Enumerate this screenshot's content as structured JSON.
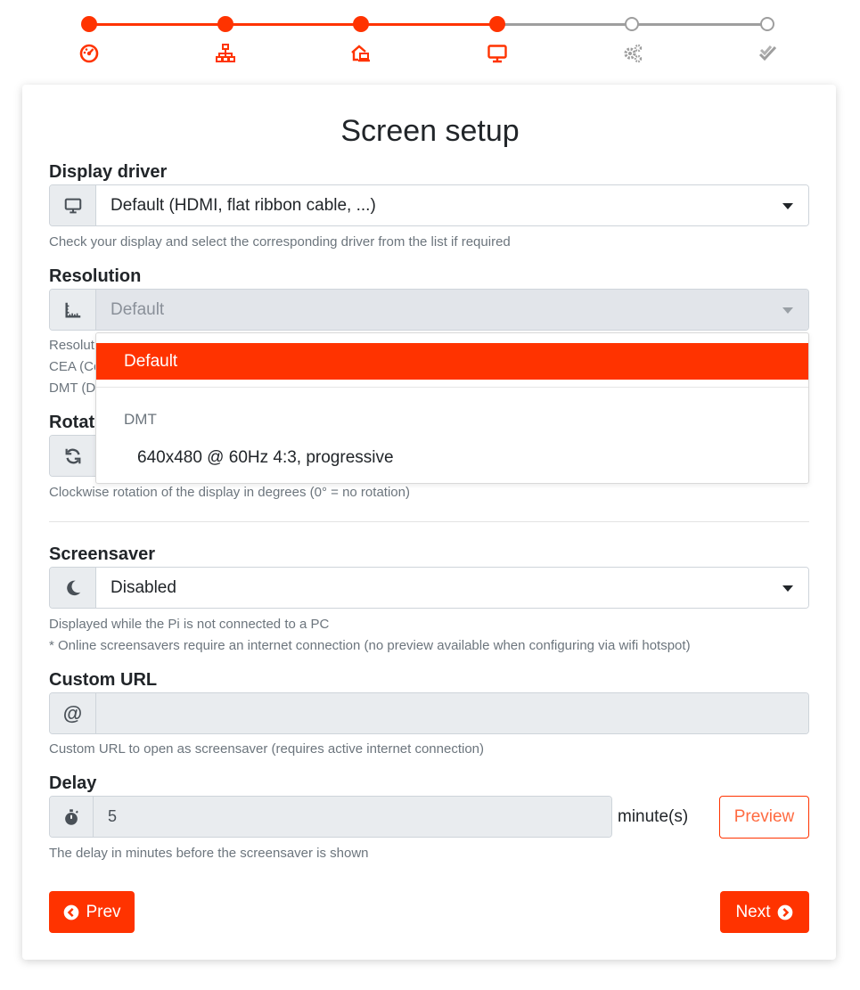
{
  "colors": {
    "accent": "#ff3300",
    "inactive": "#9e9e9e"
  },
  "stepper": {
    "steps": [
      {
        "icon": "dashboard-icon",
        "done": true
      },
      {
        "icon": "network-icon",
        "done": true
      },
      {
        "icon": "home-laptop-icon",
        "done": true
      },
      {
        "icon": "monitor-icon",
        "done": true
      },
      {
        "icon": "gears-icon",
        "done": false
      },
      {
        "icon": "double-check-icon",
        "done": false
      }
    ]
  },
  "page": {
    "title": "Screen setup"
  },
  "display_driver": {
    "label": "Display driver",
    "value": "Default (HDMI, flat ribbon cable, ...)",
    "help": "Check your display and select the corresponding driver from the list if required"
  },
  "resolution": {
    "label": "Resolution",
    "value": "Default",
    "help_lines": [
      "Resolut",
      "CEA (Co",
      "DMT (D"
    ]
  },
  "resolution_dropdown": {
    "selected": "Default",
    "group": "DMT",
    "options": [
      "640x480 @ 60Hz 4:3, progressive"
    ]
  },
  "rotation": {
    "label": "Rotat",
    "help": "Clockwise rotation of the display in degrees (0° = no rotation)"
  },
  "screensaver": {
    "label": "Screensaver",
    "value": "Disabled",
    "help_line1": "Displayed while the Pi is not connected to a PC",
    "help_line2": "* Online screensavers require an internet connection (no preview available when configuring via wifi hotspot)"
  },
  "custom_url": {
    "label": "Custom URL",
    "addon": "@",
    "value": "",
    "help": "Custom URL to open as screensaver (requires active internet connection)"
  },
  "delay": {
    "label": "Delay",
    "value": "5",
    "unit": "minute(s)",
    "preview_label": "Preview",
    "help": "The delay in minutes before the screensaver is shown"
  },
  "nav": {
    "prev_label": "Prev",
    "next_label": "Next"
  }
}
